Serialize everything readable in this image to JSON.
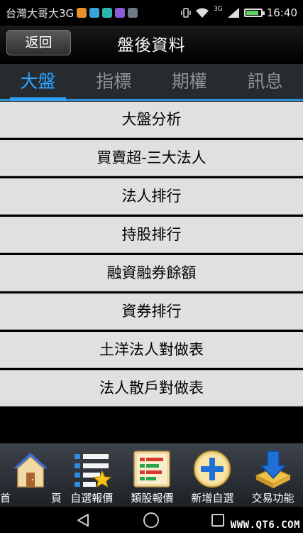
{
  "status_bar": {
    "carrier": "台灣大哥大3G",
    "network": "3G",
    "time": "16:40",
    "battery_level": 0.85
  },
  "header": {
    "back_label": "返回",
    "title": "盤後資料"
  },
  "tabs": [
    {
      "label": "大盤",
      "active": true
    },
    {
      "label": "指標",
      "active": false
    },
    {
      "label": "期權",
      "active": false
    },
    {
      "label": "訊息",
      "active": false
    }
  ],
  "menu": [
    "大盤分析",
    "買賣超-三大法人",
    "法人排行",
    "持股排行",
    "融資融券餘額",
    "資券排行",
    "土洋法人對做表",
    "法人散戶對做表"
  ],
  "toolbar": [
    {
      "label": "首 頁",
      "icon": "home-icon"
    },
    {
      "label": "自選報價",
      "icon": "watchlist-icon"
    },
    {
      "label": "類股報價",
      "icon": "sector-quote-icon"
    },
    {
      "label": "新增自選",
      "icon": "add-icon"
    },
    {
      "label": "交易功能",
      "icon": "trade-icon"
    }
  ],
  "watermark": "WWW.QT6.COM",
  "colors": {
    "accent": "#2ea3ff",
    "menu_bg": "#e0e0e0",
    "tab_bar_bg": "#262b30"
  }
}
